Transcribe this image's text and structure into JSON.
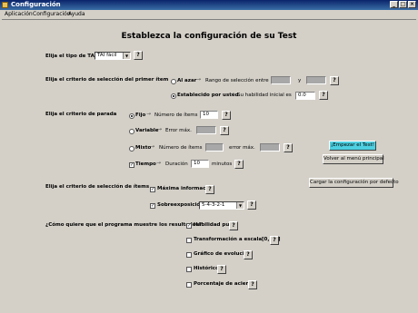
{
  "window": {
    "title": "Configuración",
    "controls": {
      "min": "_",
      "max": "□",
      "close": "×"
    }
  },
  "menu": [
    "Aplicación",
    "Configuración",
    "Ayuda"
  ],
  "heading": "Establezca la configuración de su Test",
  "help_label": "?",
  "arrow": "→",
  "tai": {
    "label": "Elija el tipo de TAI",
    "value": "TAI fácil"
  },
  "first_item": {
    "label": "Elija el criterio de selección del primer ítem",
    "random": {
      "label": "Al azar",
      "range_label": "Rango de selección entre",
      "and_label": "y",
      "selected": false
    },
    "user": {
      "label": "Establecido por usted",
      "ability_label": "Su habilidad inicial es",
      "value": "0.0",
      "selected": true
    }
  },
  "stop": {
    "label": "Elija el criterio de parada",
    "fixed": {
      "label": "Fijo",
      "items_label": "Número de ítems",
      "value": "10",
      "selected": true
    },
    "variable": {
      "label": "Variable",
      "error_label": "Error máx.",
      "selected": false
    },
    "mixed": {
      "label": "Mixto",
      "items_label": "Número de ítems",
      "error_label": "error máx.",
      "selected": false
    },
    "time": {
      "label": "Tiempo",
      "duration_label": "Duración",
      "value": "10",
      "unit": "minutos",
      "checked": true
    }
  },
  "item_selection": {
    "label": "Elija el criterio de selección de ítems",
    "max_info": {
      "label": "Máxima información",
      "checked": true
    },
    "overexposure": {
      "label": "Sobreexposición",
      "value": "5-4-3-2-1",
      "checked": true
    }
  },
  "results": {
    "label": "¿Cómo quiere que el programa muestre los resultados?",
    "options": [
      {
        "label": "Habilidad pura",
        "checked": true
      },
      {
        "label": "Transformación a escala[0, 10]",
        "checked": false
      },
      {
        "label": "Gráfico de evolución",
        "checked": false
      },
      {
        "label": "Histórico",
        "checked": false
      },
      {
        "label": "Porcentaje de aciertos",
        "checked": false
      }
    ]
  },
  "buttons": {
    "start": "¡Empezar el Test!",
    "menu": "Volver al menú principal",
    "load": "Cargar la configuración por defecto"
  },
  "colors": {
    "title_bar": "#0a246a",
    "start_button": "#4dd0e1",
    "window_bg": "#d4d0c8"
  }
}
